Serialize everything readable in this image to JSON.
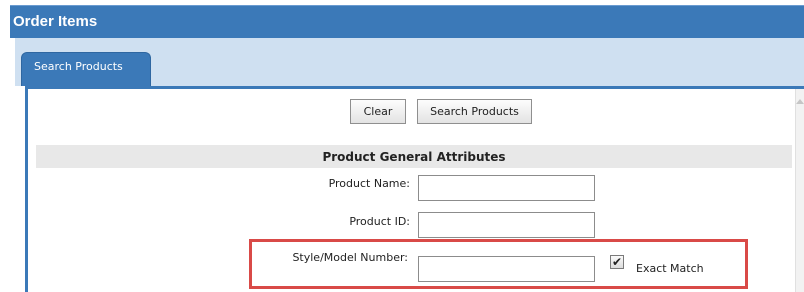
{
  "window": {
    "title": "Order Items"
  },
  "tabs": [
    {
      "label": "Search Products",
      "active": true
    }
  ],
  "toolbar": {
    "clear_label": "Clear",
    "search_label": "Search Products"
  },
  "section": {
    "title": "Product General Attributes"
  },
  "fields": {
    "product_name": {
      "label": "Product Name:",
      "value": ""
    },
    "product_id": {
      "label": "Product ID:",
      "value": ""
    },
    "style_model": {
      "label": "Style/Model Number:",
      "value": ""
    }
  },
  "exact_match": {
    "label": "Exact Match",
    "checked": true,
    "glyph": "✔"
  },
  "colors": {
    "accent": "#3b79b8",
    "tab_strip": "#cfe0f1",
    "highlight": "#d94a47",
    "section_bg": "#e8e8e8"
  }
}
